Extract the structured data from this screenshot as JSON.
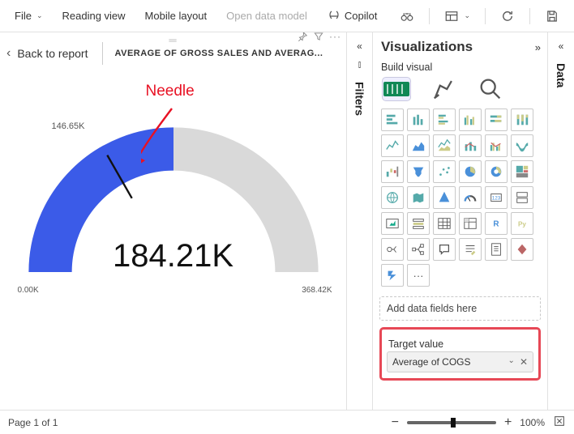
{
  "topbar": {
    "file": "File",
    "reading_view": "Reading view",
    "mobile_layout": "Mobile layout",
    "open_data_model": "Open data model",
    "copilot": "Copilot"
  },
  "report": {
    "back": "Back to report",
    "visual_title": "AVERAGE OF GROSS SALES AND AVERAG..."
  },
  "annotation": {
    "needle_label": "Needle",
    "target_tick_label": "146.65K"
  },
  "chart_data": {
    "type": "gauge",
    "min_label": "0.00K",
    "max_label": "368.42K",
    "min": 0.0,
    "max": 368.42,
    "value": 184.21,
    "value_label": "184.21K",
    "target": 146.65,
    "target_label": "146.65K",
    "fill_color": "#3b5be8",
    "track_color": "#d9d9d9"
  },
  "tabs": {
    "filters": "Filters",
    "data": "Data"
  },
  "vpane": {
    "title": "Visualizations",
    "build_visual": "Build visual",
    "add_data": "Add data fields here",
    "target_value": "Target value",
    "target_field": "Average of COGS",
    "more": "···"
  },
  "footer": {
    "page": "Page 1 of 1",
    "zoom": "100%"
  }
}
